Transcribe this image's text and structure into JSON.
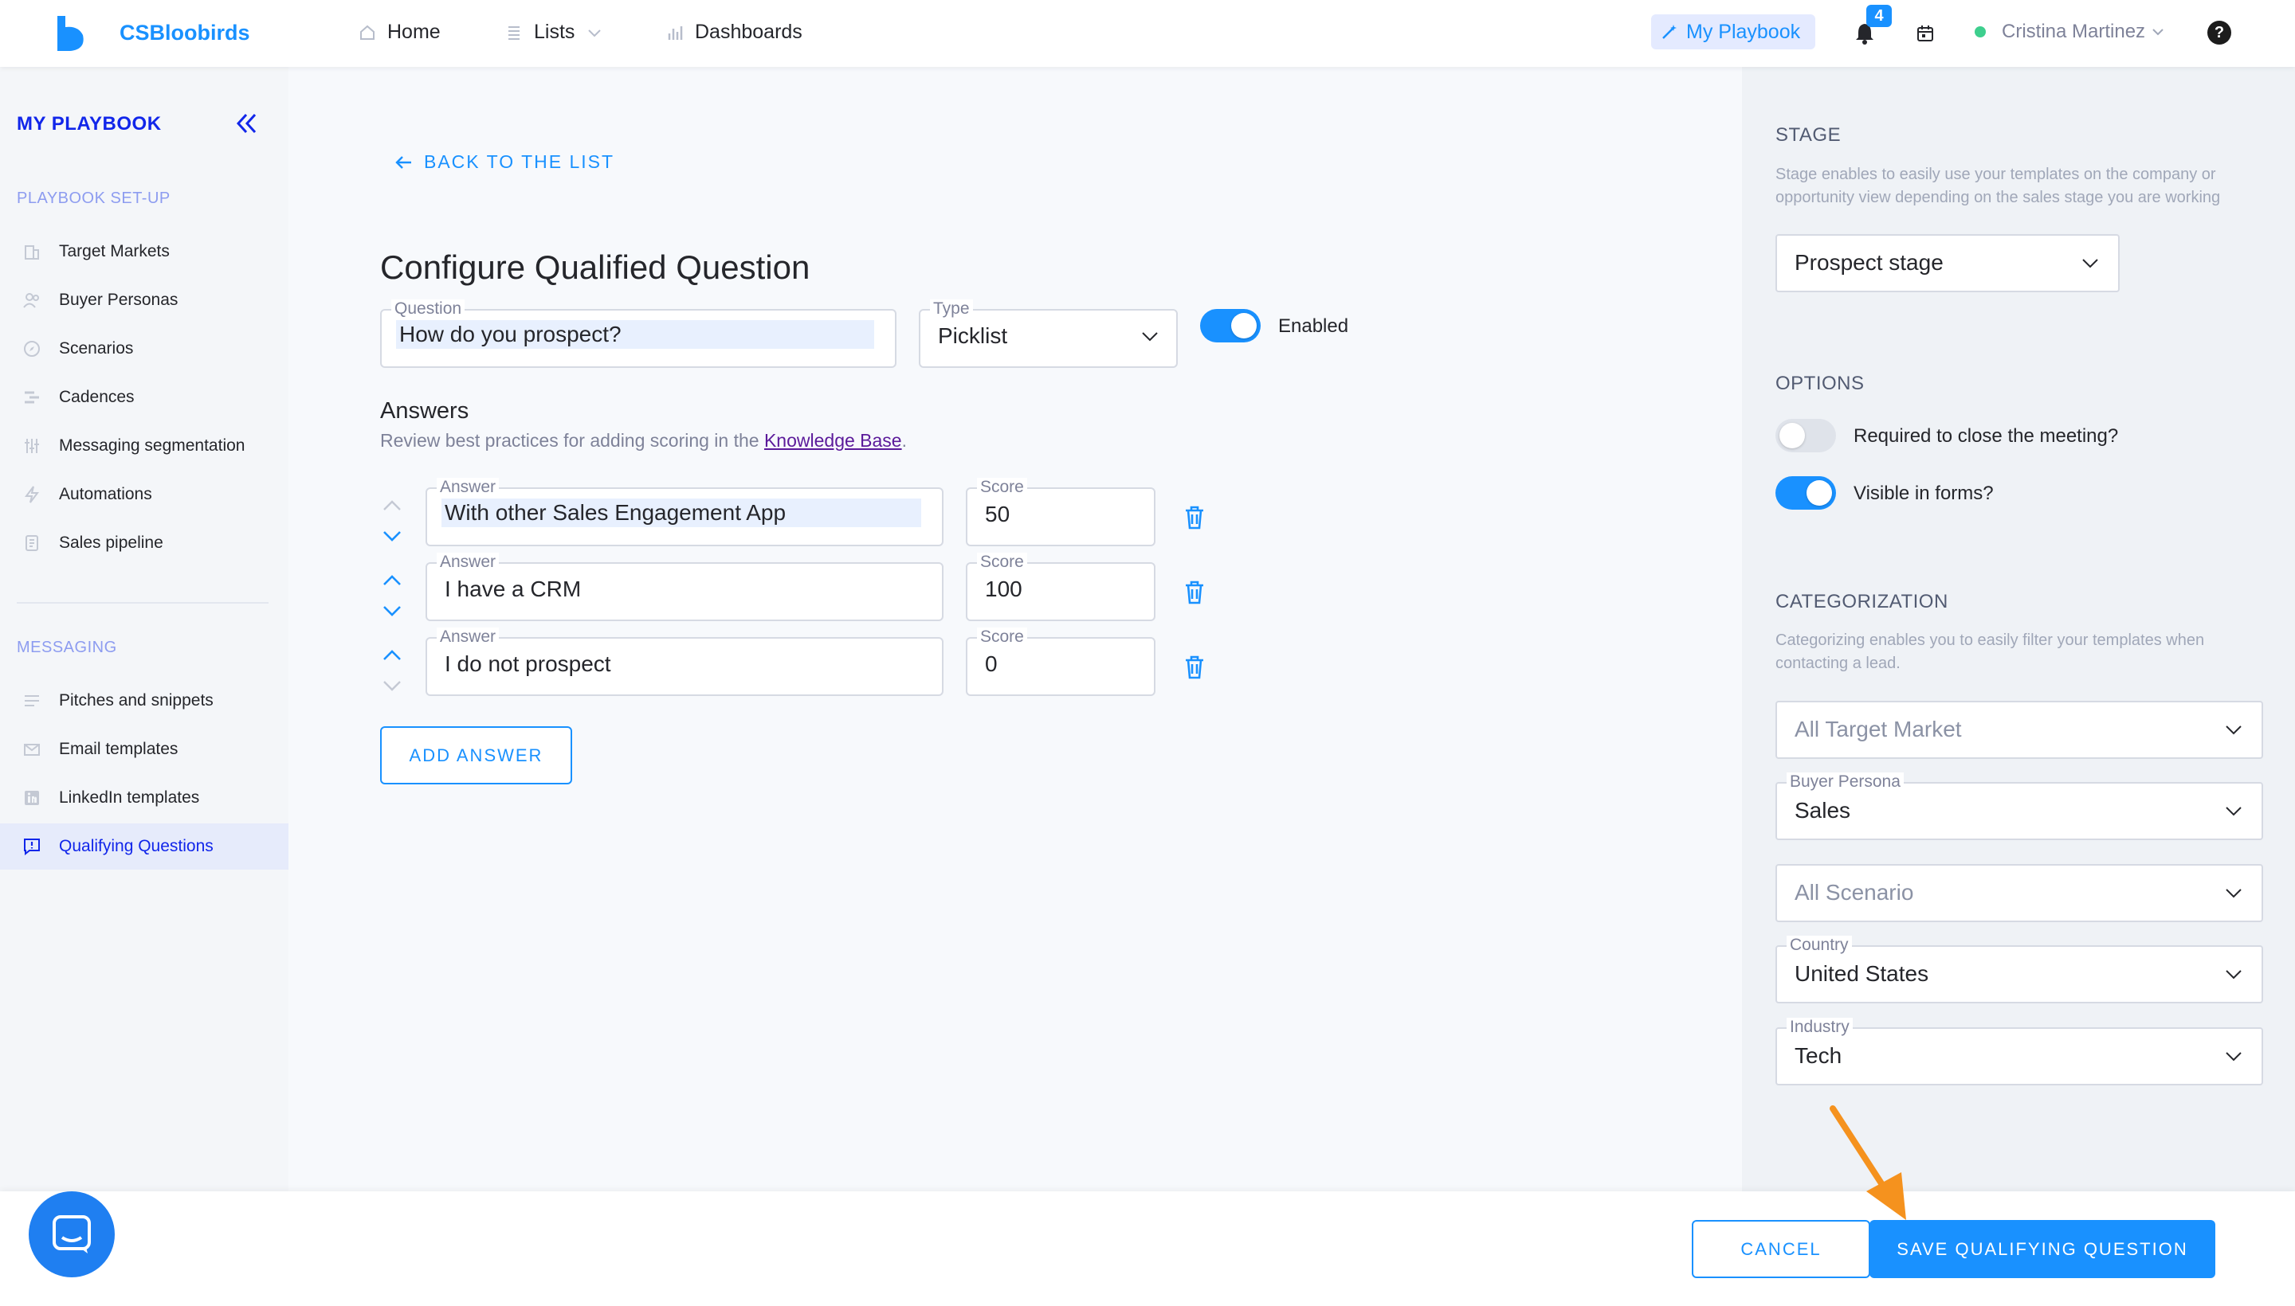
{
  "nav": {
    "brand": "CSBloobirds",
    "home": "Home",
    "lists": "Lists",
    "dashboards": "Dashboards",
    "my_playbook": "My Playbook",
    "notification_count": "4",
    "user_name": "Cristina Martinez",
    "help": "?"
  },
  "sidebar": {
    "title": "MY PLAYBOOK",
    "setup_section": "PLAYBOOK SET-UP",
    "setup_items": [
      {
        "label": "Target Markets",
        "icon": "building-icon"
      },
      {
        "label": "Buyer Personas",
        "icon": "people-icon"
      },
      {
        "label": "Scenarios",
        "icon": "compass-icon"
      },
      {
        "label": "Cadences",
        "icon": "cadence-icon"
      },
      {
        "label": "Messaging segmentation",
        "icon": "sliders-icon"
      },
      {
        "label": "Automations",
        "icon": "lightning-icon"
      },
      {
        "label": "Sales pipeline",
        "icon": "pipeline-icon"
      }
    ],
    "messaging_section": "MESSAGING",
    "messaging_items": [
      {
        "label": "Pitches and snippets",
        "icon": "lines-icon"
      },
      {
        "label": "Email templates",
        "icon": "mail-icon"
      },
      {
        "label": "LinkedIn templates",
        "icon": "linkedin-icon"
      },
      {
        "label": "Qualifying Questions",
        "icon": "question-chat-icon",
        "active": true
      }
    ]
  },
  "main": {
    "back": "BACK TO THE LIST",
    "title": "Configure Qualified Question",
    "question_label": "Question",
    "question_value": "How do you prospect?",
    "type_label": "Type",
    "type_value": "Picklist",
    "enabled_label": "Enabled",
    "enabled": true,
    "answers_heading": "Answers",
    "answers_sub_prefix": "Review best practices for adding scoring in the ",
    "answers_sub_link": "Knowledge Base",
    "answers_sub_suffix": ".",
    "answer_label": "Answer",
    "score_label": "Score",
    "answers": [
      {
        "answer": "With other Sales Engagement App",
        "score": "50"
      },
      {
        "answer": "I have a CRM",
        "score": "100"
      },
      {
        "answer": "I do not prospect",
        "score": "0"
      }
    ],
    "add_answer": "ADD ANSWER"
  },
  "panel": {
    "stage_heading": "STAGE",
    "stage_desc": "Stage enables to easily use your templates on the company or opportunity view depending on the sales stage you are working",
    "stage_value": "Prospect stage",
    "options_heading": "OPTIONS",
    "required_label": "Required to close the meeting?",
    "required": false,
    "visible_label": "Visible in forms?",
    "visible": true,
    "categorization_heading": "CATEGORIZATION",
    "categorization_desc": "Categorizing enables you to easily filter your templates when contacting a lead.",
    "target_market_placeholder": "All Target Market",
    "buyer_persona_label": "Buyer Persona",
    "buyer_persona_value": "Sales",
    "scenario_placeholder": "All Scenario",
    "country_label": "Country",
    "country_value": "United States",
    "industry_label": "Industry",
    "industry_value": "Tech"
  },
  "footer": {
    "cancel": "CANCEL",
    "save": "SAVE QUALIFYING QUESTION"
  },
  "colors": {
    "accent": "#1991ff",
    "sidebar_active": "#1126ea",
    "annotation_arrow": "#f5921e"
  }
}
